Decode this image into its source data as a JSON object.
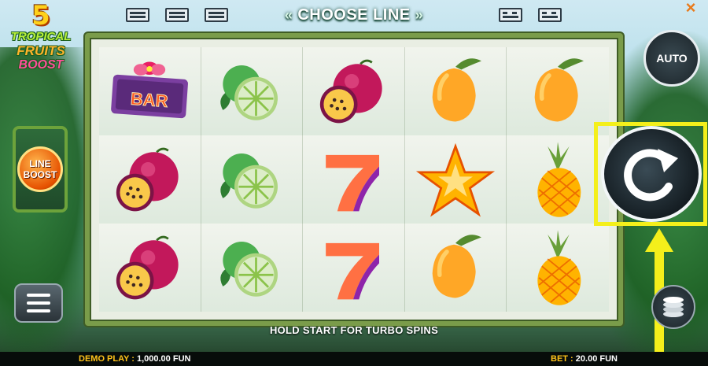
{
  "top_bar": {
    "title": "CHOOSE LINE",
    "left_arrows": "«",
    "right_arrows": "»",
    "line_indicators": [
      "line-pattern-1",
      "line-pattern-2",
      "line-pattern-3",
      "line-pattern-4",
      "line-pattern-5"
    ]
  },
  "logo": {
    "number": "5",
    "line1": "TROPICAL",
    "line2": "FRUITS",
    "line3": "BOOST"
  },
  "line_boost": {
    "line1": "LINE",
    "line2": "BOOST"
  },
  "reels": {
    "columns": 5,
    "rows": 3,
    "symbols": [
      [
        "bar",
        "lime",
        "passion-fruit",
        "mango",
        "mango"
      ],
      [
        "passion-fruit",
        "lime",
        "seven",
        "star-fruit",
        "pineapple"
      ],
      [
        "passion-fruit",
        "lime",
        "seven",
        "mango",
        "pineapple"
      ]
    ],
    "bar_label": "BAR"
  },
  "controls": {
    "auto_label": "AUTO",
    "spin_icon": "spin-arrow-icon",
    "menu_icon": "hamburger-menu-icon",
    "bet_icon": "coin-stack-icon",
    "close_icon": "close-icon",
    "highlight_color": "#f4ef1b"
  },
  "hint": "HOLD START FOR TURBO SPINS",
  "footer": {
    "demo_label": "DEMO PLAY :",
    "demo_value": "1,000.00 FUN",
    "bet_label": "BET :",
    "bet_value": "20.00 FUN"
  }
}
